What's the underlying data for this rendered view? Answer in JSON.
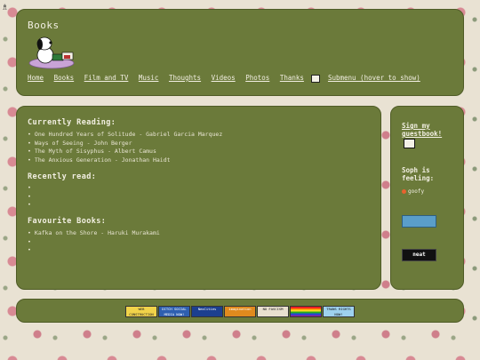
{
  "header": {
    "title": "Books",
    "nav": [
      "Home",
      "Books",
      "Film and TV",
      "Music",
      "Thoughts",
      "Videos",
      "Photos",
      "Thanks"
    ],
    "submenu": "Submenu (hover to show)"
  },
  "main": {
    "currently_reading_title": "Currently Reading:",
    "currently_reading": [
      "One Hundred Years of Solitude - Gabriel Garcia Marquez",
      "Ways of Seeing - John Berger",
      "The Myth of Sisyphus - Albert Camus",
      "The Anxious Generation - Jonathan Haidt"
    ],
    "recently_read_title": "Recently read:",
    "recently_read": [
      "",
      "",
      ""
    ],
    "favourite_title": "Favourite Books:",
    "favourite": [
      "Kafka on the Shore - Haruki Murakami",
      "",
      ""
    ]
  },
  "sidebar": {
    "guestbook": "Sign my guestbook!",
    "feeling_label": "Soph is feeling:",
    "mood": "goofy",
    "badge_text": "",
    "neat_badge": "neat"
  },
  "footer": {
    "buttons": [
      {
        "text": "WEB CONSTRUCTION",
        "bg": "#f1d34a",
        "fg": "#222"
      },
      {
        "text": "DITCH SOCIAL MEDIA NOW!",
        "bg": "#2e5fb0",
        "fg": "#fff"
      },
      {
        "text": "NeoCities",
        "bg": "#1c3f8f",
        "fg": "#fff"
      },
      {
        "text": "imagination",
        "bg": "#e08a1e",
        "fg": "#fff"
      },
      {
        "text": "NO FASCISM",
        "bg": "#e9e0cf",
        "fg": "#111"
      },
      {
        "text": "",
        "bg": "#c33",
        "fg": "#fff"
      },
      {
        "text": "TRANS RIGHTS NOW!",
        "bg": "#9ed1ee",
        "fg": "#111"
      }
    ]
  }
}
